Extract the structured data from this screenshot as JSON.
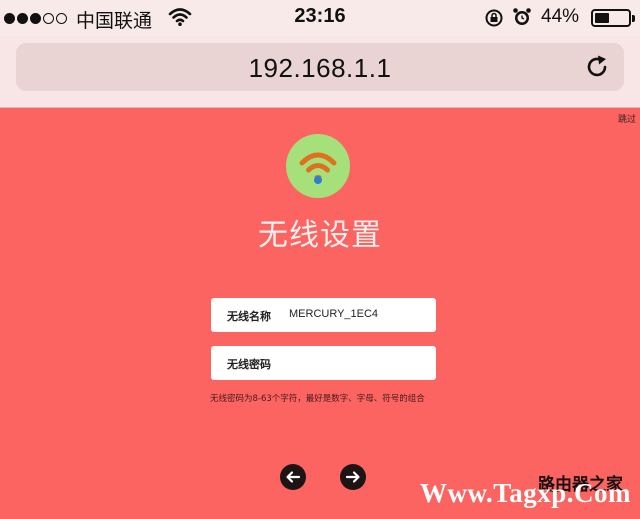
{
  "status_bar": {
    "signal_bars": 5,
    "signal_filled": 3,
    "carrier": "中国联通",
    "time": "23:16",
    "battery_percent_text": "44%",
    "battery_level": 0.44
  },
  "browser": {
    "url": "192.168.1.1",
    "reload_icon": "reload-icon"
  },
  "page": {
    "skip_link": "跳过",
    "title": "无线设置",
    "logo_icon": "wifi-icon",
    "colors": {
      "background": "#fb6461",
      "logo": "#a5e07a",
      "wifi_arcs": "#e0701f",
      "wifi_dot": "#2a7fd4"
    },
    "wireless_name": {
      "label": "无线名称",
      "value": "MERCURY_1EC4"
    },
    "wireless_password": {
      "label": "无线密码",
      "value": ""
    },
    "hint": "无线密码为8-63个字符，最好是数字、字母、符号的组合",
    "back_icon": "arrow-left-icon",
    "next_icon": "arrow-right-icon"
  },
  "watermark": {
    "site": "Www.Tagxp.Com",
    "brand": "路由器之家"
  }
}
